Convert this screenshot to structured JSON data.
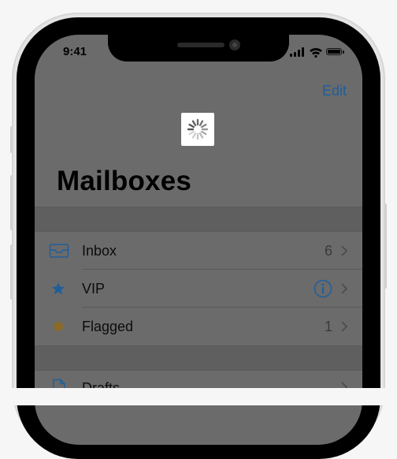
{
  "status_bar": {
    "time": "9:41"
  },
  "nav": {
    "edit_label": "Edit"
  },
  "page": {
    "title": "Mailboxes"
  },
  "mailboxes": [
    {
      "label": "Inbox",
      "count": "6",
      "icon": "inbox-tray-icon",
      "icon_color": "#1f5e9a"
    },
    {
      "label": "VIP",
      "count": "",
      "icon": "star-icon",
      "icon_color": "#1f5e9a",
      "accessory": "info-icon"
    },
    {
      "label": "Flagged",
      "count": "1",
      "icon": "flag-dot-icon",
      "icon_color": "#8a6a2a"
    },
    {
      "label": "Drafts",
      "count": "",
      "icon": "document-icon",
      "icon_color": "#1f5e9a"
    }
  ],
  "colors": {
    "screen_dim": "#6b6b6b",
    "accent": "#1f5e9a",
    "device_frame": "#e4e4e4"
  }
}
